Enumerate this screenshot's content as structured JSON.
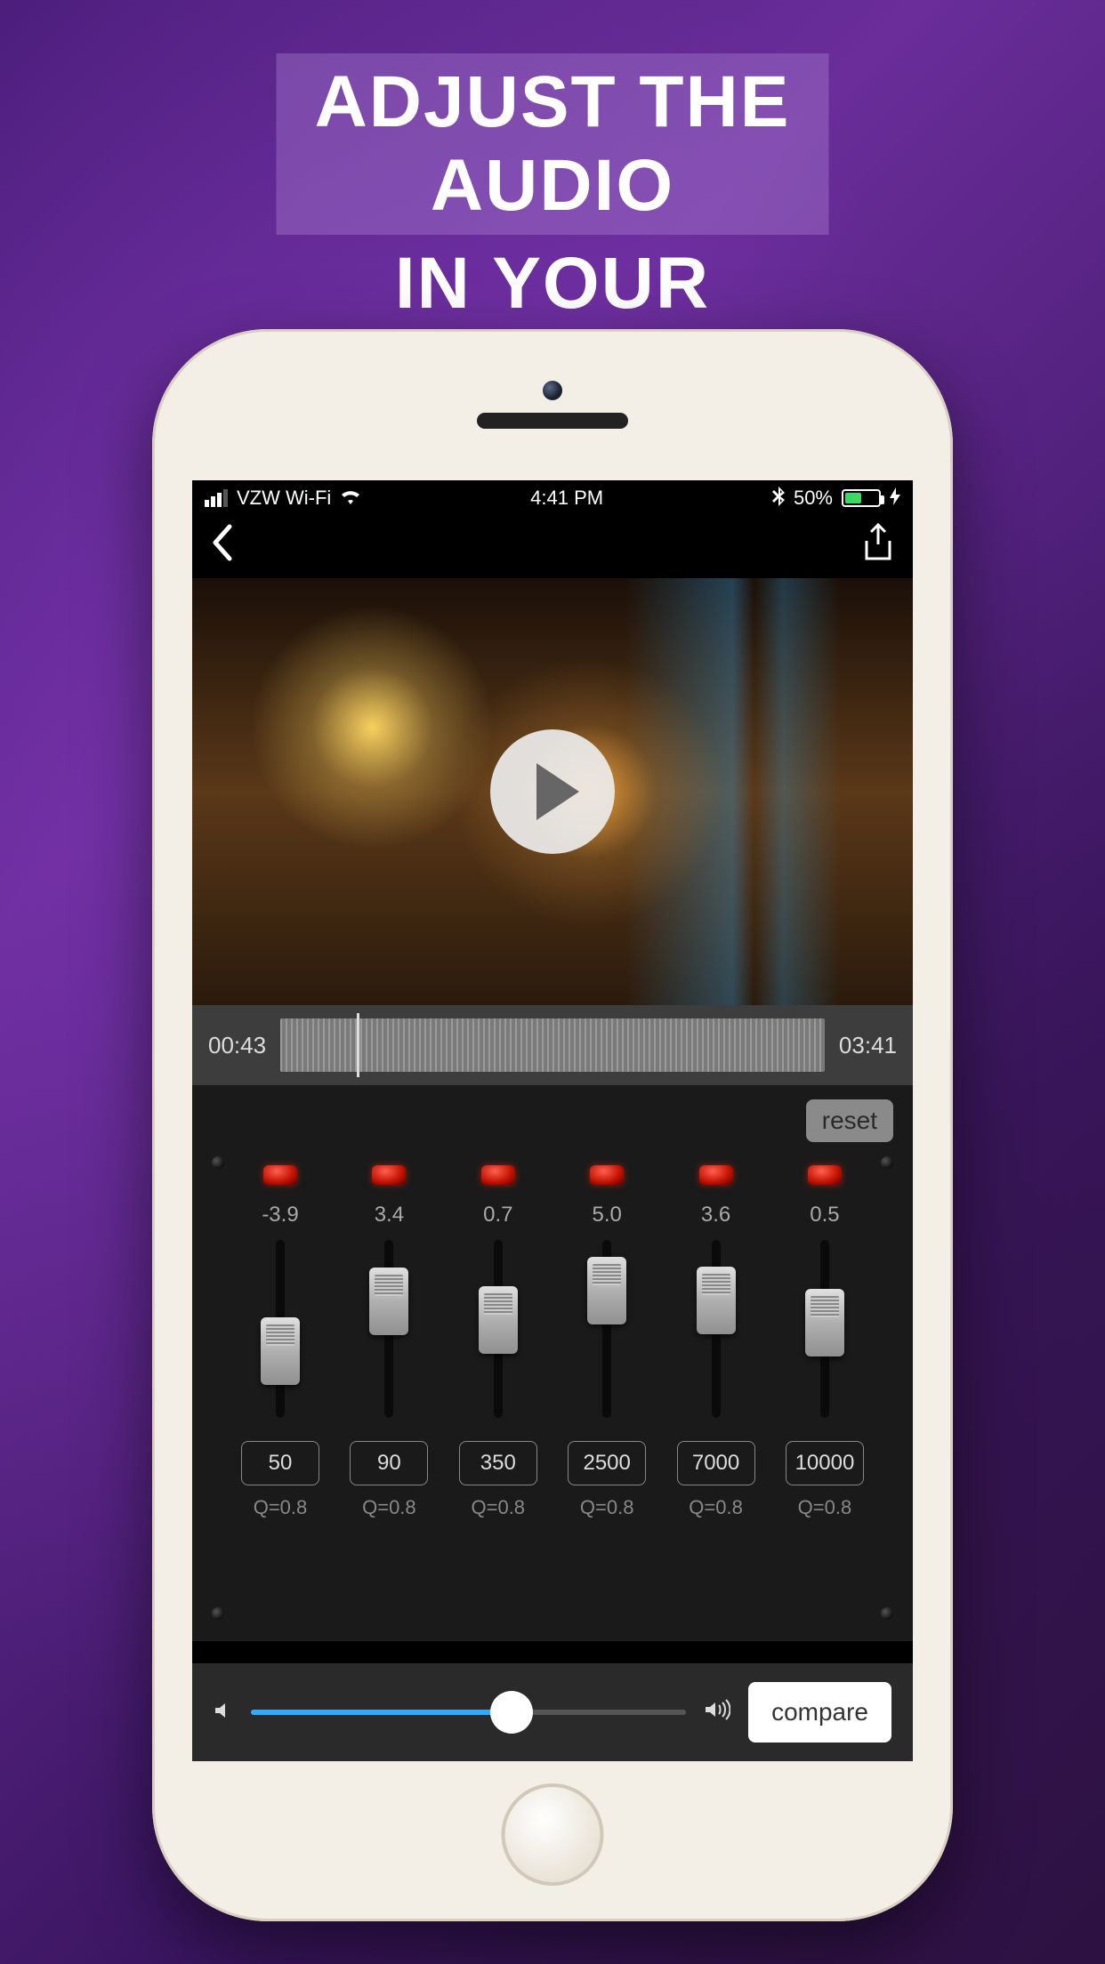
{
  "promo": {
    "line1": "ADJUST THE AUDIO",
    "line2": "IN YOUR VIDEOS"
  },
  "status": {
    "carrier": "VZW Wi-Fi",
    "time": "4:41 PM",
    "battery_percent": "50%"
  },
  "timeline": {
    "current": "00:43",
    "total": "03:41"
  },
  "eq": {
    "reset_label": "reset",
    "bands": [
      {
        "gain": "-3.9",
        "freq": "50",
        "q": "Q=0.8",
        "knob_pos": 0.7
      },
      {
        "gain": "3.4",
        "freq": "90",
        "q": "Q=0.8",
        "knob_pos": 0.25
      },
      {
        "gain": "0.7",
        "freq": "350",
        "q": "Q=0.8",
        "knob_pos": 0.42
      },
      {
        "gain": "5.0",
        "freq": "2500",
        "q": "Q=0.8",
        "knob_pos": 0.15
      },
      {
        "gain": "3.6",
        "freq": "7000",
        "q": "Q=0.8",
        "knob_pos": 0.24
      },
      {
        "gain": "0.5",
        "freq": "10000",
        "q": "Q=0.8",
        "knob_pos": 0.44
      }
    ]
  },
  "bottom": {
    "volume": 0.6,
    "compare_label": "compare"
  }
}
